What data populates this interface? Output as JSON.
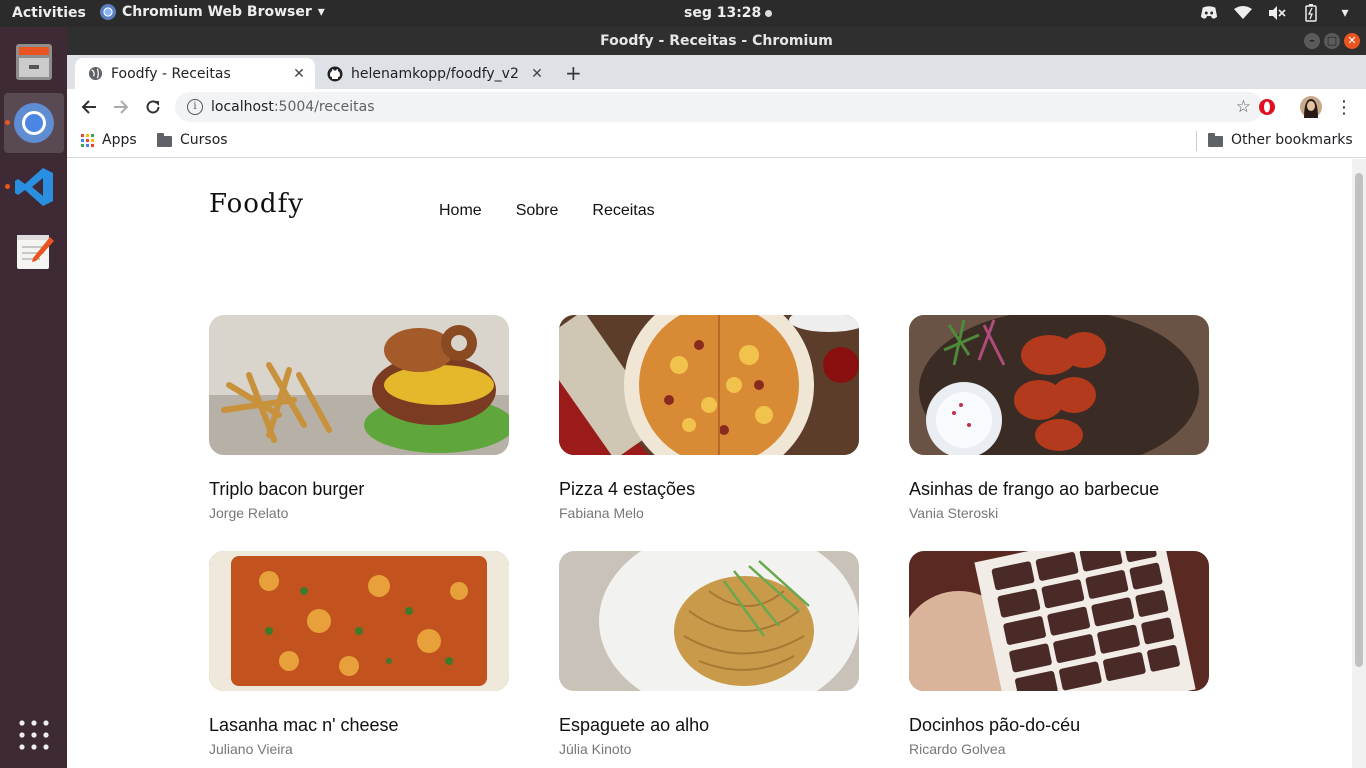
{
  "topbar": {
    "activities": "Activities",
    "app_menu": "Chromium Web Browser",
    "clock": "seg 13:28"
  },
  "window": {
    "title": "Foodfy - Receitas - Chromium"
  },
  "tabs": [
    {
      "title": "Foodfy - Receitas",
      "icon": "globe-icon",
      "active": true
    },
    {
      "title": "helenamkopp/foodfy_v2",
      "icon": "github-icon",
      "active": false
    }
  ],
  "address_bar": {
    "host": "localhost",
    "path": ":5004/receitas"
  },
  "bookmarks": {
    "apps": "Apps",
    "cursos": "Cursos",
    "other": "Other bookmarks"
  },
  "page": {
    "logo": "Foodfy",
    "nav": [
      "Home",
      "Sobre",
      "Receitas"
    ],
    "recipes": [
      {
        "title": "Triplo bacon burger",
        "author": "Jorge Relato"
      },
      {
        "title": "Pizza 4 estações",
        "author": "Fabiana Melo"
      },
      {
        "title": "Asinhas de frango ao barbecue",
        "author": "Vania Steroski"
      },
      {
        "title": "Lasanha mac n' cheese",
        "author": "Juliano Vieira"
      },
      {
        "title": "Espaguete ao alho",
        "author": "Júlia Kinoto"
      },
      {
        "title": "Docinhos pão-do-céu",
        "author": "Ricardo Golvea"
      }
    ]
  },
  "colors": {
    "ubuntu_orange": "#e95420",
    "dock_bg": "#3d2a35",
    "topbar_bg": "#2b2b2b",
    "author_gray": "#777777"
  }
}
